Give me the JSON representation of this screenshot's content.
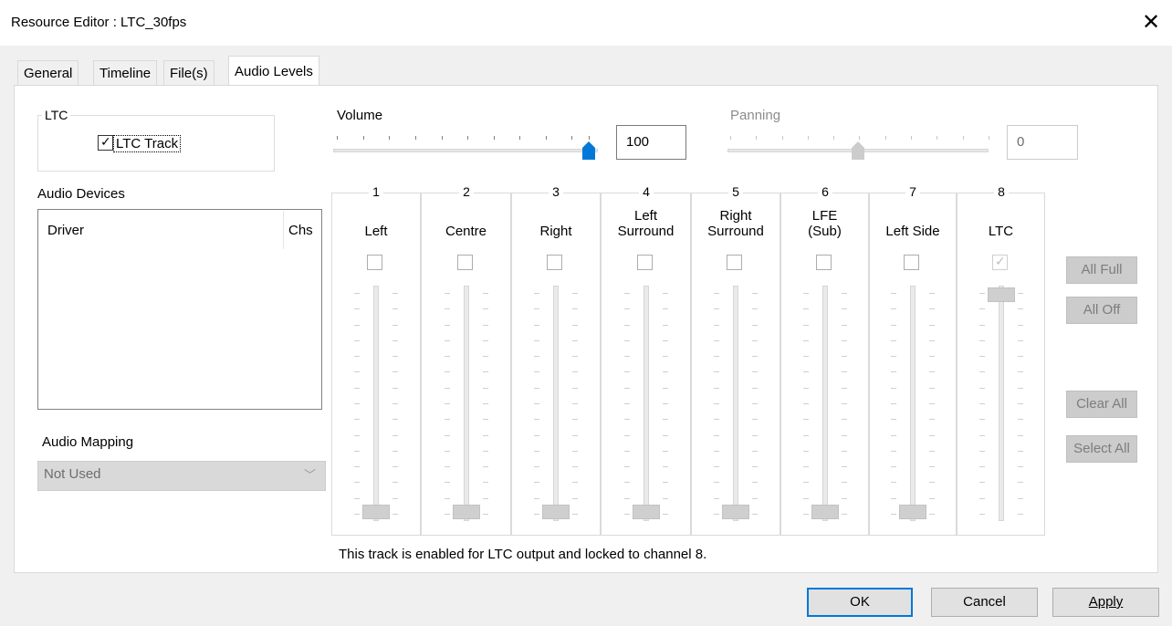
{
  "window": {
    "title": "Resource Editor  :  LTC_30fps",
    "close_glyph": "✕"
  },
  "tabs": [
    {
      "label": "General"
    },
    {
      "label": "Timeline"
    },
    {
      "label": "File(s)"
    },
    {
      "label": "Audio Levels",
      "active": true
    }
  ],
  "ltc_group": {
    "label": "LTC",
    "ltc_track": {
      "label": "LTC Track",
      "checked": true
    }
  },
  "audio_devices": {
    "label": "Audio Devices",
    "columns": [
      "Driver",
      "Chs"
    ]
  },
  "audio_mapping": {
    "label": "Audio Mapping",
    "value": "Not Used"
  },
  "volume": {
    "label": "Volume",
    "value": "100",
    "level": 100
  },
  "panning": {
    "label": "Panning",
    "value": "0",
    "enabled": false
  },
  "channels": [
    {
      "number": "1",
      "name_line1": "",
      "name_line2": "Left",
      "enabled_box": false,
      "level": 0
    },
    {
      "number": "2",
      "name_line1": "",
      "name_line2": "Centre",
      "enabled_box": false,
      "level": 0
    },
    {
      "number": "3",
      "name_line1": "",
      "name_line2": "Right",
      "enabled_box": false,
      "level": 0
    },
    {
      "number": "4",
      "name_line1": "Left",
      "name_line2": "Surround",
      "enabled_box": false,
      "level": 0
    },
    {
      "number": "5",
      "name_line1": "Right",
      "name_line2": "Surround",
      "enabled_box": false,
      "level": 0
    },
    {
      "number": "6",
      "name_line1": "LFE",
      "name_line2": "(Sub)",
      "enabled_box": false,
      "level": 0
    },
    {
      "number": "7",
      "name_line1": "",
      "name_line2": "Left Side",
      "enabled_box": false,
      "level": 0
    },
    {
      "number": "8",
      "name_line1": "",
      "name_line2": "LTC",
      "enabled_box": true,
      "level": 100
    }
  ],
  "side_buttons": {
    "all_full": "All Full",
    "all_off": "All Off",
    "clear_all": "Clear All",
    "select_all": "Select All"
  },
  "status_text": "This track is enabled for LTC output and locked to channel 8.",
  "footer": {
    "ok": "OK",
    "cancel": "Cancel",
    "apply": "Apply"
  }
}
